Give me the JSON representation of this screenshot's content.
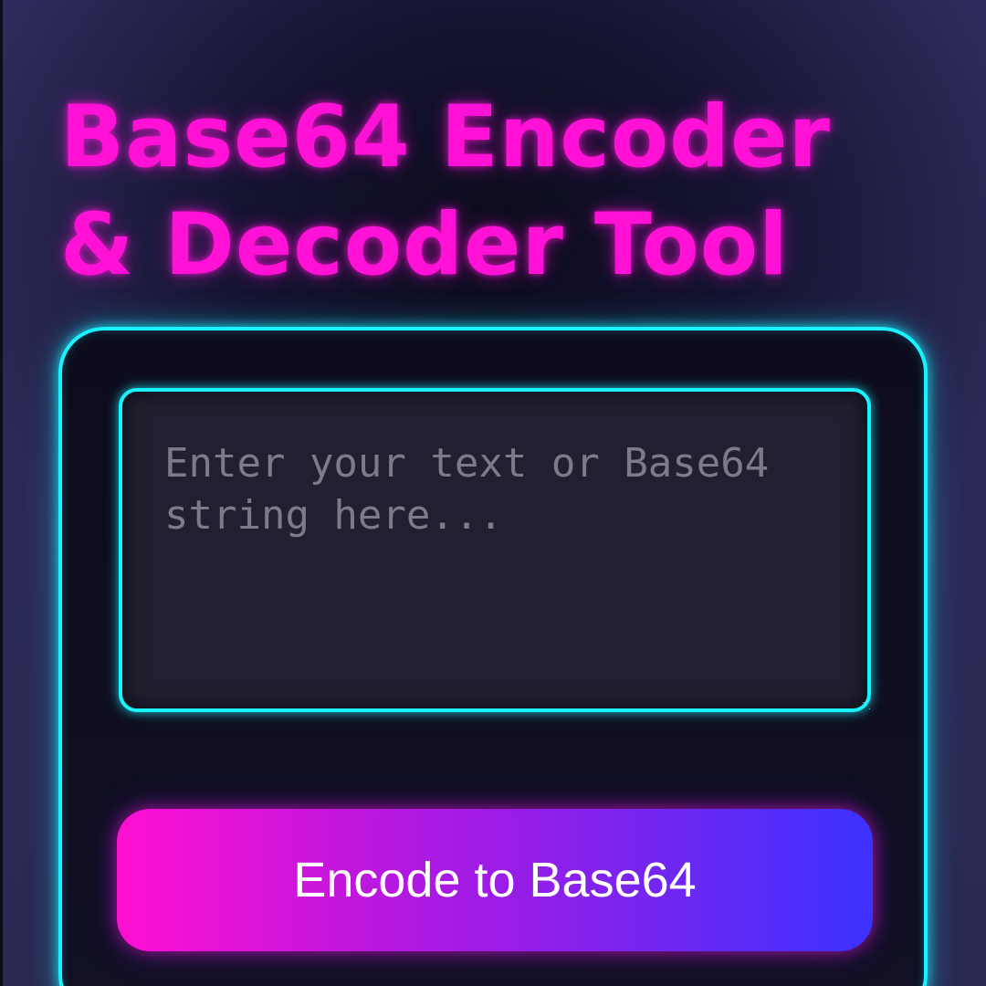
{
  "app": {
    "title": "Base64 Encoder & Decoder Tool"
  },
  "input": {
    "value": "",
    "placeholder": "Enter your text or Base64 string here..."
  },
  "actions": {
    "encode_label": "Encode to Base64"
  },
  "colors": {
    "title": "#ff12d6",
    "accent_cyan": "#19f2ff",
    "button_gradient_start": "#ff10d0",
    "button_gradient_end": "#3d32ff",
    "card_background": "#0d0c1d",
    "input_background": "#202030",
    "page_background": "#2e2c5c"
  }
}
